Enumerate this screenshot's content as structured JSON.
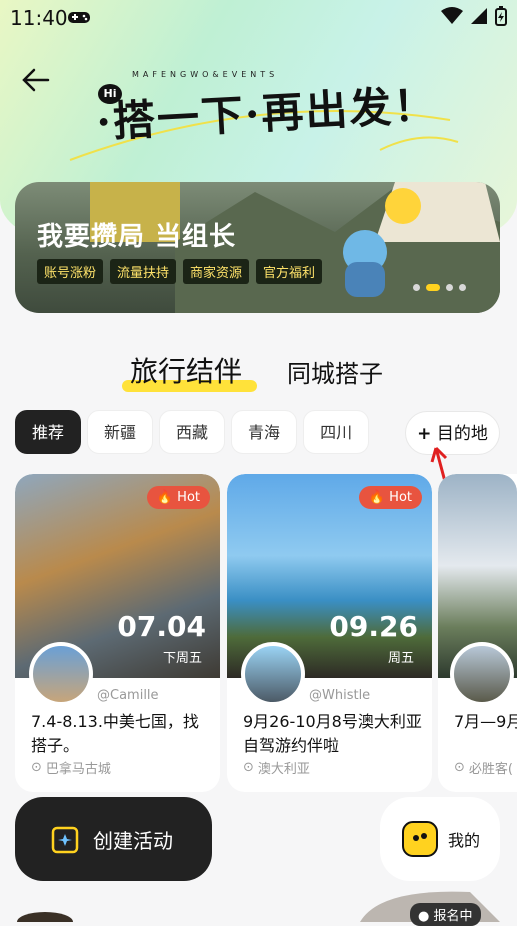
{
  "status": {
    "time": "11:40"
  },
  "header": {
    "logo_sub": "MAFENGWO&EVENTS",
    "logo_main": "·搭一下·再出发！",
    "logo_hi": "Hi"
  },
  "banner": {
    "title": "我要攒局 当组长",
    "tags": [
      "账号涨粉",
      "流量扶持",
      "商家资源",
      "官方福利"
    ]
  },
  "tabs": {
    "main": "旅行结伴",
    "sub": "同城搭子"
  },
  "chips": [
    "推荐",
    "新疆",
    "西藏",
    "青海",
    "四川"
  ],
  "destination_button": "目的地",
  "cards": [
    {
      "hot": "Hot",
      "date": "07.04",
      "weekday": "下周五",
      "handle": "@Camille",
      "title": "7.4-8.13.中美七国，找搭子。",
      "location": "巴拿马古城"
    },
    {
      "hot": "Hot",
      "date": "09.26",
      "weekday": "周五",
      "handle": "@Whistle",
      "title": "9月26-10月8号澳大利亚自驾游约伴啦",
      "location": "澳大利亚"
    },
    {
      "title": "7月—9月",
      "location": "必胜客("
    }
  ],
  "create_button": "创建活动",
  "mine_button": "我的",
  "registration_badge": "报名中",
  "colors": {
    "accent": "#ffe23a",
    "hot": "#e8543f",
    "dark": "#222222"
  }
}
